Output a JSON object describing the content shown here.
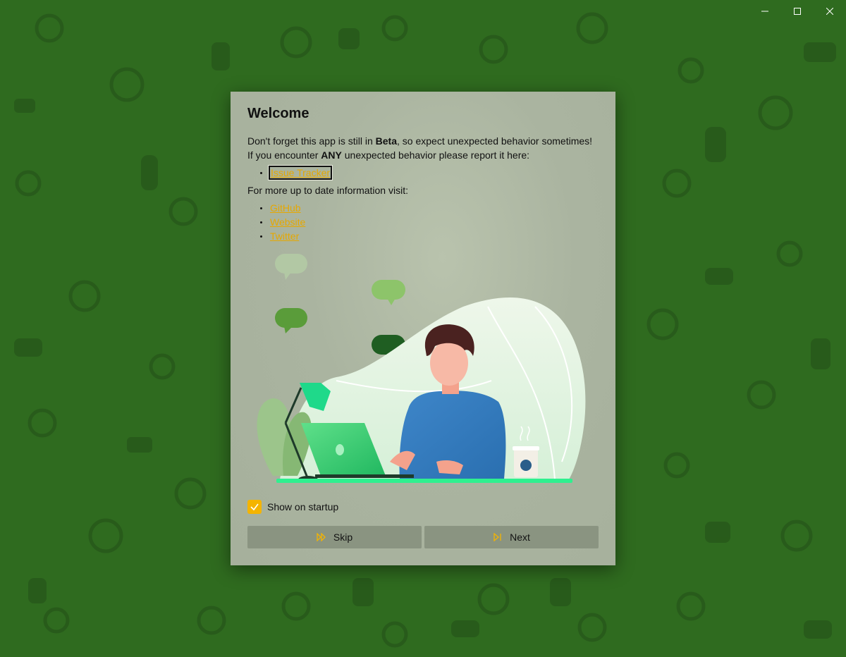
{
  "window_controls": {
    "minimize_icon": "minimize-icon",
    "maximize_icon": "maximize-icon",
    "close_icon": "close-icon"
  },
  "dialog": {
    "title": "Welcome",
    "beta_line": {
      "prefix": "Don't forget this app is still in ",
      "emphasis": "Beta",
      "suffix": ", so expect unexpected behavior sometimes!"
    },
    "report_line": {
      "prefix": "If you encounter ",
      "emphasis": "ANY",
      "suffix": " unexpected behavior please report it here:"
    },
    "report_links": [
      {
        "label": "Issue Tracker"
      }
    ],
    "info_line": "For more up to date information visit:",
    "info_links": [
      {
        "label": "GitHub"
      },
      {
        "label": "Website"
      },
      {
        "label": "Twitter"
      }
    ],
    "show_on_startup": {
      "label": "Show on startup",
      "checked": true
    },
    "buttons": {
      "skip_label": "Skip",
      "next_label": "Next"
    }
  },
  "colors": {
    "accent": "#f4b400",
    "link": "#e6a800",
    "background": "#2f6b1f",
    "button": "#8a9481"
  }
}
